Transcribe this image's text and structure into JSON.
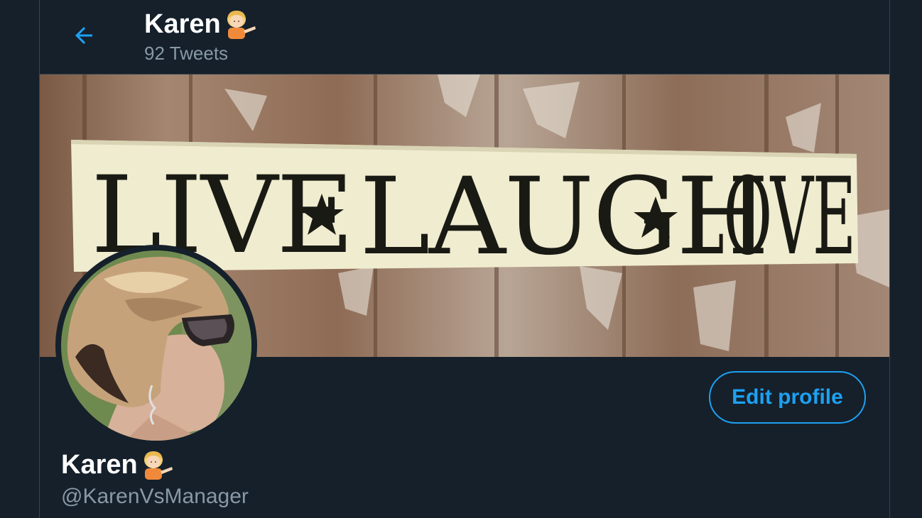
{
  "header": {
    "name": "Karen",
    "name_emoji": "woman-tipping-hand-emoji",
    "tweet_count": "92 Tweets",
    "back_icon": "arrow-left-icon"
  },
  "banner": {
    "sign_text": [
      "LIVE",
      "LAUGH",
      "LOVE"
    ]
  },
  "profile": {
    "name": "Karen",
    "name_emoji": "woman-tipping-hand-emoji",
    "handle": "@KarenVsManager",
    "edit_label": "Edit profile"
  },
  "colors": {
    "background": "#15202b",
    "border": "#38444d",
    "accent": "#1da1f2",
    "secondary_text": "#8899a6",
    "primary_text": "#ffffff"
  }
}
